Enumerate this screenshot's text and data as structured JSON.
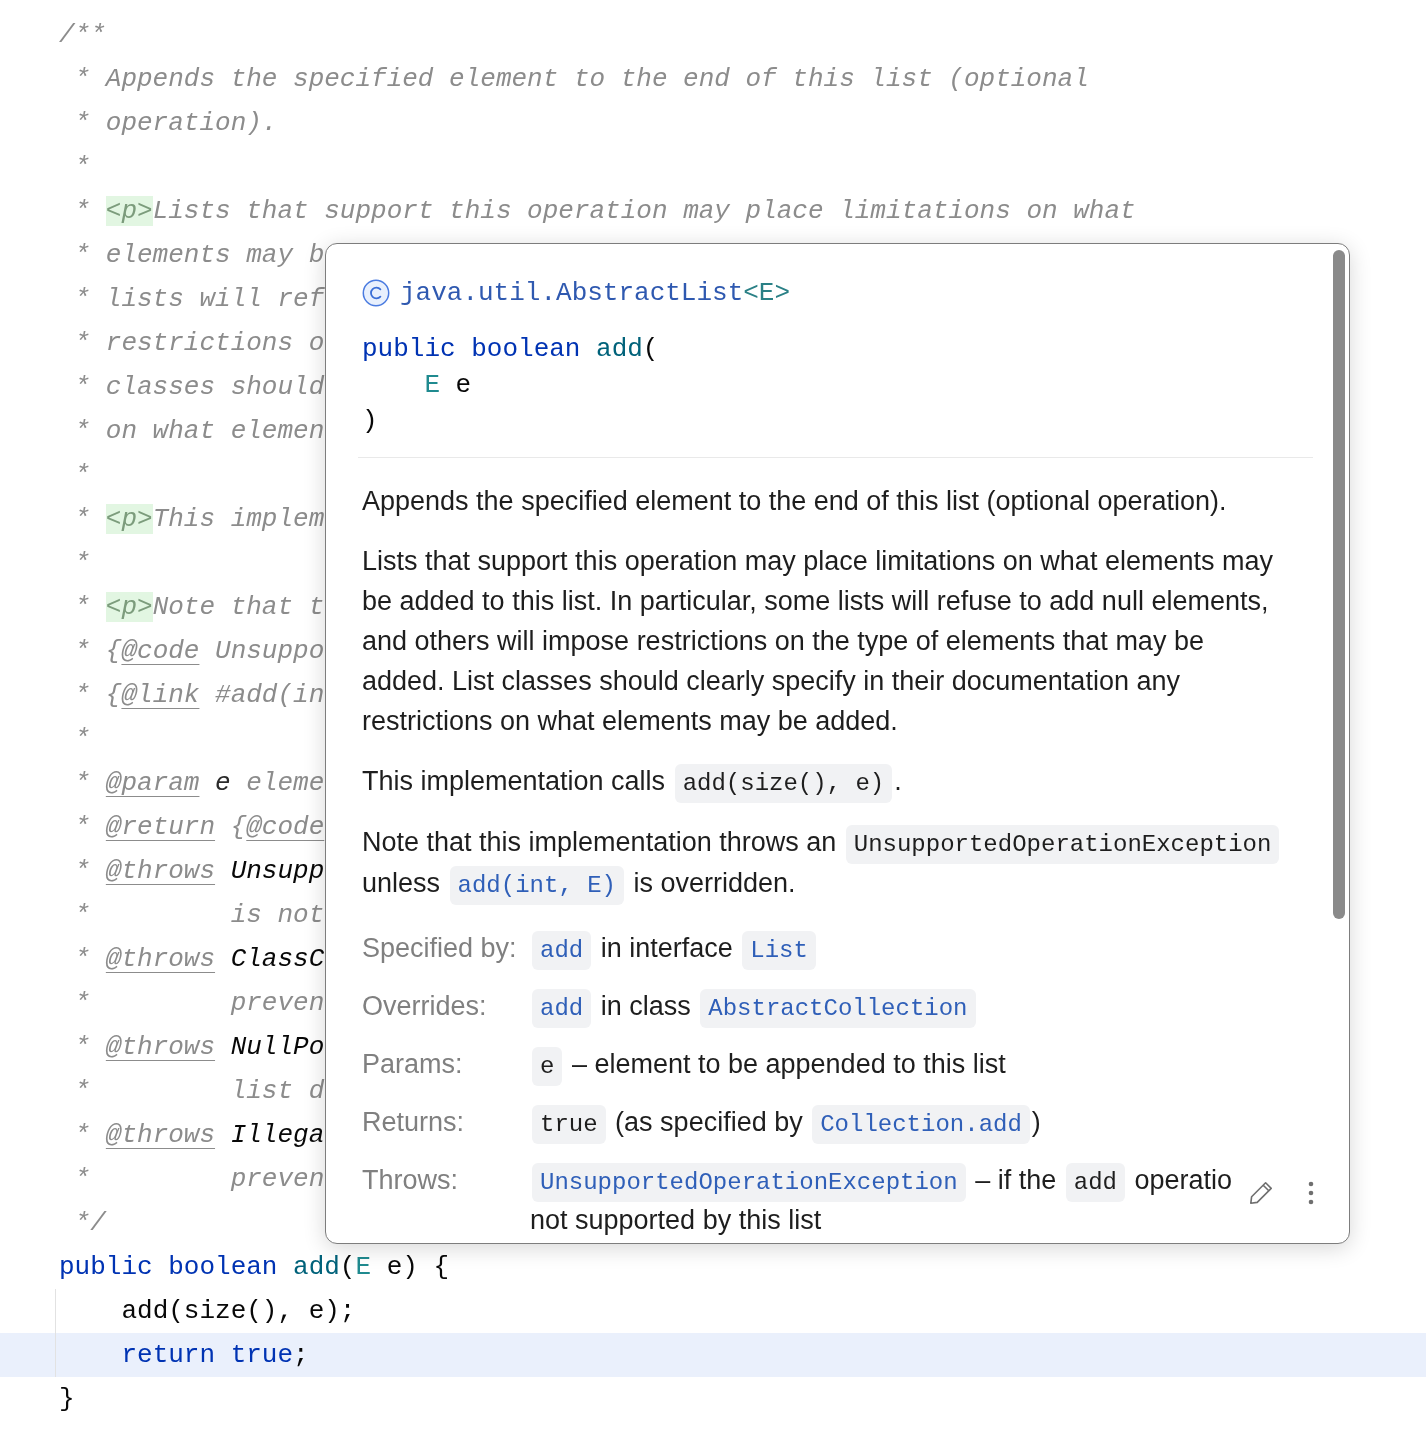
{
  "code_lines": [
    {
      "current": false,
      "segments": [
        {
          "kind": "comment",
          "text": "/**"
        }
      ]
    },
    {
      "current": false,
      "segments": [
        {
          "kind": "comment",
          "text": " * Appends the specified element to the end of this list (optional"
        }
      ]
    },
    {
      "current": false,
      "segments": [
        {
          "kind": "comment",
          "text": " * operation)."
        }
      ]
    },
    {
      "current": false,
      "segments": [
        {
          "kind": "comment",
          "text": " *"
        }
      ]
    },
    {
      "current": false,
      "segments": [
        {
          "kind": "comment",
          "text": " * "
        },
        {
          "kind": "html_tag",
          "text": "<p>"
        },
        {
          "kind": "comment",
          "text": "Lists that support this operation may place limitations on what"
        }
      ]
    },
    {
      "current": false,
      "segments": [
        {
          "kind": "comment",
          "text": " * elements may b"
        }
      ]
    },
    {
      "current": false,
      "segments": [
        {
          "kind": "comment",
          "text": " * lists will ref"
        }
      ]
    },
    {
      "current": false,
      "segments": [
        {
          "kind": "comment",
          "text": " * restrictions o"
        }
      ]
    },
    {
      "current": false,
      "segments": [
        {
          "kind": "comment",
          "text": " * classes should"
        }
      ]
    },
    {
      "current": false,
      "segments": [
        {
          "kind": "comment",
          "text": " * on what elemen"
        }
      ]
    },
    {
      "current": false,
      "segments": [
        {
          "kind": "comment",
          "text": " *"
        }
      ]
    },
    {
      "current": false,
      "segments": [
        {
          "kind": "comment",
          "text": " * "
        },
        {
          "kind": "html_tag",
          "text": "<p>"
        },
        {
          "kind": "comment",
          "text": "This implem"
        }
      ]
    },
    {
      "current": false,
      "segments": [
        {
          "kind": "comment",
          "text": " *"
        }
      ]
    },
    {
      "current": false,
      "segments": [
        {
          "kind": "comment",
          "text": " * "
        },
        {
          "kind": "html_tag",
          "text": "<p>"
        },
        {
          "kind": "comment",
          "text": "Note that t"
        }
      ]
    },
    {
      "current": false,
      "segments": [
        {
          "kind": "comment",
          "text": " * {"
        },
        {
          "kind": "doc_tag",
          "text": "@code"
        },
        {
          "kind": "comment",
          "text": " Unsuppo"
        }
      ]
    },
    {
      "current": false,
      "segments": [
        {
          "kind": "comment",
          "text": " * {"
        },
        {
          "kind": "doc_tag",
          "text": "@link"
        },
        {
          "kind": "comment",
          "text": " #add(in"
        }
      ]
    },
    {
      "current": false,
      "segments": [
        {
          "kind": "comment",
          "text": " *"
        }
      ]
    },
    {
      "current": false,
      "segments": [
        {
          "kind": "comment",
          "text": " * "
        },
        {
          "kind": "doc_tag",
          "text": "@param"
        },
        {
          "kind": "doc_param",
          "text": " e"
        },
        {
          "kind": "comment",
          "text": " eleme"
        }
      ]
    },
    {
      "current": false,
      "segments": [
        {
          "kind": "comment",
          "text": " * "
        },
        {
          "kind": "doc_tag",
          "text": "@return"
        },
        {
          "kind": "comment",
          "text": " {"
        },
        {
          "kind": "doc_tag",
          "text": "@code"
        }
      ]
    },
    {
      "current": false,
      "segments": [
        {
          "kind": "comment",
          "text": " * "
        },
        {
          "kind": "doc_tag",
          "text": "@throws"
        },
        {
          "kind": "doc_class",
          "text": " Unsupp"
        }
      ]
    },
    {
      "current": false,
      "segments": [
        {
          "kind": "comment",
          "text": " *         is not"
        }
      ]
    },
    {
      "current": false,
      "segments": [
        {
          "kind": "comment",
          "text": " * "
        },
        {
          "kind": "doc_tag",
          "text": "@throws"
        },
        {
          "kind": "doc_class",
          "text": " ClassC"
        }
      ]
    },
    {
      "current": false,
      "segments": [
        {
          "kind": "comment",
          "text": " *         preven"
        }
      ]
    },
    {
      "current": false,
      "segments": [
        {
          "kind": "comment",
          "text": " * "
        },
        {
          "kind": "doc_tag",
          "text": "@throws"
        },
        {
          "kind": "doc_class",
          "text": " NullPo"
        }
      ]
    },
    {
      "current": false,
      "segments": [
        {
          "kind": "comment",
          "text": " *         list d"
        }
      ]
    },
    {
      "current": false,
      "segments": [
        {
          "kind": "comment",
          "text": " * "
        },
        {
          "kind": "doc_tag",
          "text": "@throws"
        },
        {
          "kind": "doc_class",
          "text": " Illega"
        }
      ]
    },
    {
      "current": false,
      "segments": [
        {
          "kind": "comment",
          "text": " *         preven"
        }
      ]
    },
    {
      "current": false,
      "segments": [
        {
          "kind": "comment",
          "text": " */"
        }
      ]
    },
    {
      "current": false,
      "segments": [
        {
          "kind": "keyword",
          "text": "public boolean "
        },
        {
          "kind": "method",
          "text": "add"
        },
        {
          "kind": "plain",
          "text": "("
        },
        {
          "kind": "type_param",
          "text": "E"
        },
        {
          "kind": "plain",
          "text": " e) {"
        }
      ]
    },
    {
      "current": false,
      "segments": [
        {
          "kind": "plain",
          "text": "    add(size(), e);"
        }
      ]
    },
    {
      "current": true,
      "segments": [
        {
          "kind": "keyword",
          "text": "    return true"
        },
        {
          "kind": "plain",
          "text": ";"
        }
      ]
    },
    {
      "current": false,
      "segments": [
        {
          "kind": "plain",
          "text": "}"
        }
      ]
    }
  ],
  "doc_popup": {
    "class_name": "java.util.AbstractList",
    "type_params": "<E>",
    "signature": [
      [
        {
          "kind": "keyword",
          "text": "public boolean "
        },
        {
          "kind": "method",
          "text": "add"
        },
        {
          "kind": "plain",
          "text": "("
        }
      ],
      [
        {
          "kind": "type_param",
          "text": "    E"
        },
        {
          "kind": "plain",
          "text": " e"
        }
      ],
      [
        {
          "kind": "plain",
          "text": ")"
        }
      ]
    ],
    "paragraphs": [
      [
        {
          "kind": "text",
          "text": "Appends the specified element to the end of this list (optional operation)."
        }
      ],
      [
        {
          "kind": "text",
          "text": "Lists that support this operation may place limitations on what elements may be added to this list. In particular, some lists will refuse to add null elements, and others will impose restrictions on the type of elements that may be added. List classes should clearly specify in their documentation any restrictions on what elements may be added."
        }
      ],
      [
        {
          "kind": "text",
          "text": "This implementation calls "
        },
        {
          "kind": "code",
          "text": "add(size(), e)"
        },
        {
          "kind": "text",
          "text": "."
        }
      ],
      [
        {
          "kind": "text",
          "text": "Note that this implementation throws an "
        },
        {
          "kind": "code",
          "text": "UnsupportedOperationException"
        },
        {
          "kind": "text",
          "text": " unless "
        },
        {
          "kind": "link",
          "text": "add(int, E)"
        },
        {
          "kind": "text",
          "text": " is overridden."
        }
      ]
    ],
    "sections": [
      {
        "label": "Specified by:",
        "lines": [
          [
            {
              "kind": "link",
              "text": "add"
            },
            {
              "kind": "text",
              "text": " in interface "
            },
            {
              "kind": "link",
              "text": "List"
            }
          ]
        ]
      },
      {
        "label": "Overrides:",
        "lines": [
          [
            {
              "kind": "link",
              "text": "add"
            },
            {
              "kind": "text",
              "text": " in class "
            },
            {
              "kind": "link",
              "text": "AbstractCollection"
            }
          ]
        ]
      },
      {
        "label": "Params:",
        "lines": [
          [
            {
              "kind": "code",
              "text": "e"
            },
            {
              "kind": "text",
              "text": " – element to be appended to this list"
            }
          ]
        ]
      },
      {
        "label": "Returns:",
        "lines": [
          [
            {
              "kind": "code",
              "text": "true"
            },
            {
              "kind": "text",
              "text": " (as specified by "
            },
            {
              "kind": "link",
              "text": "Collection.add"
            },
            {
              "kind": "text",
              "text": ")"
            }
          ]
        ]
      },
      {
        "label": "Throws:",
        "lines": [
          [
            {
              "kind": "link",
              "text": "UnsupportedOperationException"
            },
            {
              "kind": "text",
              "text": " – if the "
            },
            {
              "kind": "code",
              "text": "add"
            },
            {
              "kind": "text",
              "text": " operatio"
            }
          ],
          [
            {
              "kind": "text",
              "text": "not supported by this list"
            }
          ]
        ]
      }
    ]
  }
}
